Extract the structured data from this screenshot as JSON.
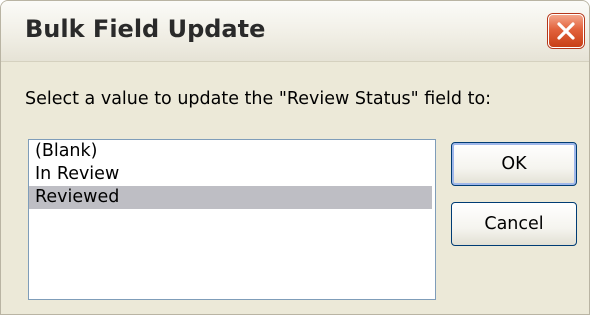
{
  "dialog": {
    "title": "Bulk Field Update",
    "close_icon": "close-x-icon",
    "instruction": "Select a value to update the \"Review Status\" field to:",
    "list": {
      "items": [
        "(Blank)",
        "In Review",
        "Reviewed"
      ],
      "selected": "Reviewed"
    },
    "buttons": {
      "ok": "OK",
      "cancel": "Cancel"
    },
    "colors": {
      "face": "#ece9d8",
      "close_button": "#e2623c",
      "selection": "#bebec4",
      "button_border": "#003c74"
    }
  }
}
